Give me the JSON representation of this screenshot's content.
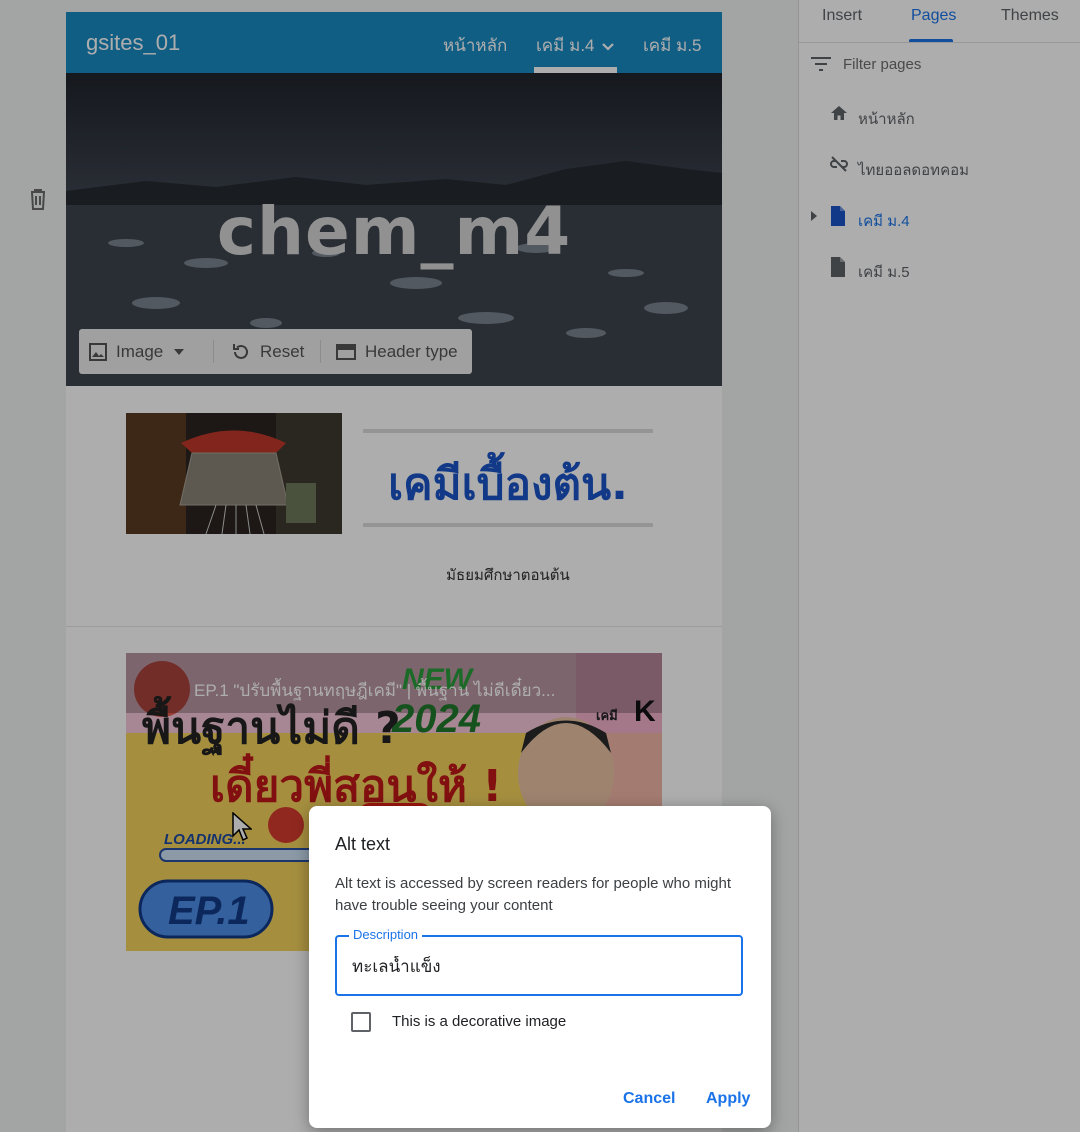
{
  "site": {
    "title": "gsites_01",
    "nav": {
      "home": "หน้าหลัก",
      "m4": "เคมี ม.4",
      "m5": "เคมี ม.5"
    },
    "hero_title": "chem_m4",
    "toolbar": {
      "image": "Image",
      "reset": "Reset",
      "header_type": "Header type"
    },
    "heading": "เคมีเบื้องต้น.",
    "subtext": "มัธยมศึกษาตอนต้น",
    "video": {
      "title": "EP.1 \"ปรับพื้นฐานทฤษฎีเคมี\" | พื้นฐาน ไม่ดีเดี๋ยว...",
      "line1": "พื้นฐานไม่ดี ?",
      "line2": "เดี๋ยวพี่สอนให้ !",
      "new_badge": "NEW",
      "year": "2024",
      "loading": "LOADING...",
      "episode": "EP.1",
      "brand": "เคมี",
      "brand_k": "K"
    }
  },
  "sidebar": {
    "tabs": {
      "insert": "Insert",
      "pages": "Pages",
      "themes": "Themes"
    },
    "filter_placeholder": "Filter pages",
    "pages": [
      {
        "label": "หน้าหลัก",
        "icon": "home-icon"
      },
      {
        "label": "ไทยออลดอทคอม",
        "icon": "link-off-icon"
      },
      {
        "label": "เคมี ม.4",
        "icon": "page-icon",
        "active": true
      },
      {
        "label": "เคมี ม.5",
        "icon": "page-icon"
      }
    ]
  },
  "dialog": {
    "title": "Alt text",
    "description": "Alt text is accessed by screen readers for people who might have trouble seeing your content",
    "field_label": "Description",
    "field_value": "ทะเลน้ำแข็ง",
    "checkbox_label": "This is a decorative image",
    "cancel": "Cancel",
    "apply": "Apply"
  },
  "colors": {
    "nav_bar": "#1a8bc4",
    "accent": "#1a73e8",
    "heading": "#1a55c7"
  }
}
